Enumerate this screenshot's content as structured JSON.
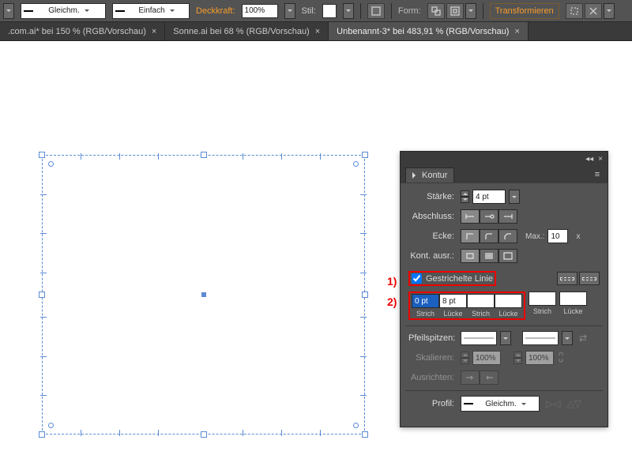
{
  "toolbar": {
    "stroke_style_1": "Gleichm.",
    "stroke_style_2": "Einfach",
    "opacity_label": "Deckkraft:",
    "opacity_value": "100%",
    "stil_label": "Stil:",
    "form_label": "Form:",
    "transform_label": "Transformieren"
  },
  "tabs": [
    {
      "label": ".com.ai* bei 150 % (RGB/Vorschau)",
      "active": false
    },
    {
      "label": "Sonne.ai bei 68 % (RGB/Vorschau)",
      "active": false
    },
    {
      "label": "Unbenannt-3* bei 483,91 % (RGB/Vorschau)",
      "active": true
    }
  ],
  "panel": {
    "title": "Kontur",
    "weight_label": "Stärke:",
    "weight_value": "4 pt",
    "cap_label": "Abschluss:",
    "corner_label": "Ecke:",
    "miter_label": "Max.:",
    "miter_value": "10",
    "miter_unit": "x",
    "align_label": "Kont. ausr.:",
    "dashed_label": "Gestrichelte Linie",
    "dash_cells": [
      {
        "value": "0 pt",
        "label": "Strich",
        "selected": true
      },
      {
        "value": "8 pt",
        "label": "Lücke"
      },
      {
        "value": "",
        "label": "Strich"
      },
      {
        "value": "",
        "label": "Lücke"
      },
      {
        "value": "",
        "label": "Strich"
      },
      {
        "value": "",
        "label": "Lücke"
      }
    ],
    "arrow_label": "Pfeilspitzen:",
    "scale_label": "Skalieren:",
    "scale_value_1": "100%",
    "scale_value_2": "100%",
    "alignarrow_label": "Ausrichten:",
    "profile_label": "Profil:",
    "profile_value": "Gleichm."
  },
  "annotations": {
    "n1": "1)",
    "n2": "2)"
  }
}
